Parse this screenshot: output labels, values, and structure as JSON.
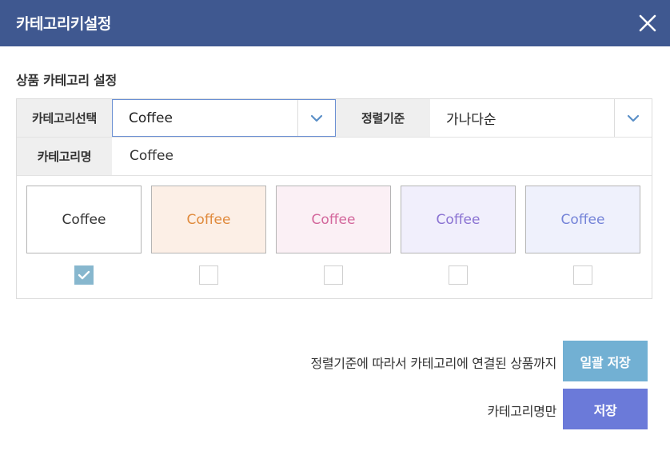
{
  "dialog": {
    "title": "카테고리키설정",
    "close_icon": "close-icon"
  },
  "section_title": "상품 카테고리 설정",
  "form": {
    "category_select_label": "카테고리선택",
    "category_select_value": "Coffee",
    "sort_label": "정렬기준",
    "sort_value": "가나다순",
    "category_name_label": "카테고리명",
    "category_name_value": "Coffee"
  },
  "swatches": [
    {
      "text": "Coffee",
      "bg": "#ffffff",
      "color": "#333333",
      "checked": true
    },
    {
      "text": "Coffee",
      "bg": "#fcefe6",
      "color": "#e08a3c",
      "checked": false
    },
    {
      "text": "Coffee",
      "bg": "#fbf0f5",
      "color": "#d3669b",
      "checked": false
    },
    {
      "text": "Coffee",
      "bg": "#f1effc",
      "color": "#8a72d2",
      "checked": false
    },
    {
      "text": "Coffee",
      "bg": "#eff1fc",
      "color": "#7483d8",
      "checked": false
    }
  ],
  "actions": {
    "bulk_label": "정렬기준에 따라서 카테고리에 연결된 상품까지",
    "bulk_button": "일괄 저장",
    "name_only_label": "카테고리명만",
    "save_button": "저장"
  },
  "colors": {
    "titlebar": "#3f5890",
    "bulk_button": "#72b0d3",
    "save_button": "#6b7ad9",
    "select_focus_border": "#6a8fd3",
    "checkbox_checked": "#87b7ce"
  }
}
